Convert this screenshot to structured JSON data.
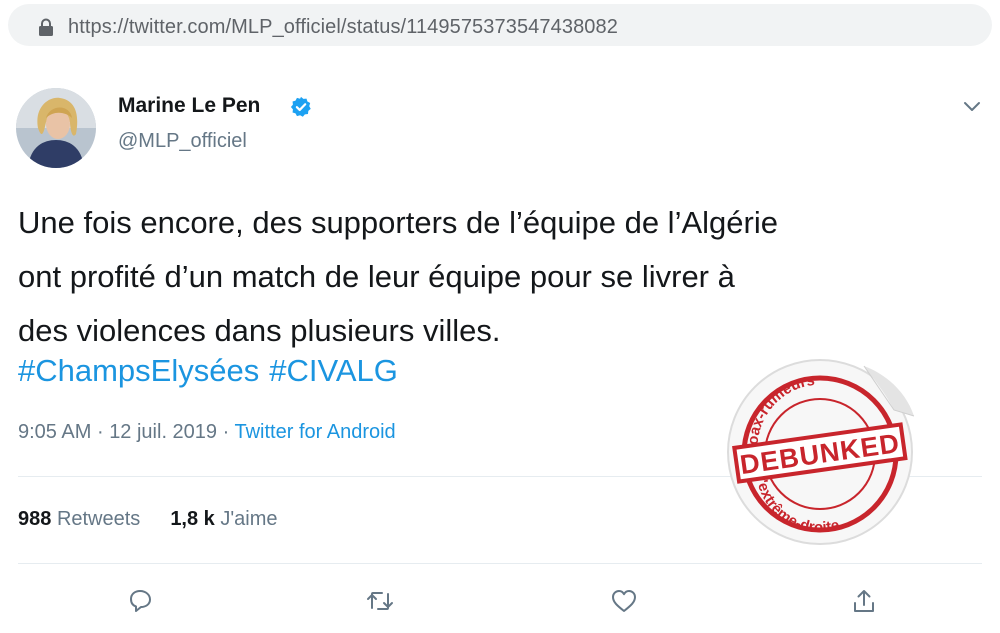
{
  "browser": {
    "url": "https://twitter.com/MLP_officiel/status/1149575373547438082"
  },
  "tweet": {
    "author_name": "Marine Le Pen",
    "author_handle": "@MLP_officiel",
    "text_lines": [
      "Une fois encore, des supporters de l’équipe de l’Algérie",
      "ont profité d’un match de leur équipe pour se livrer à",
      "des violences dans plusieurs villes."
    ],
    "hashtags": [
      "#ChampsElysées",
      "#CIVALG"
    ],
    "time": "9:05 AM",
    "separator": "·",
    "date": "12 juil. 2019",
    "source": "Twitter for Android",
    "retweets_count": "988",
    "retweets_label": "Retweets",
    "likes_count": "1,8 k",
    "likes_label": "J'aime"
  },
  "stamp": {
    "top_text": "Hoax-rumeurs",
    "center_text": "DEBUNKED",
    "bottom_text": "d'extrême-droite"
  },
  "colors": {
    "link": "#1b95e0",
    "secondary_text": "#657786",
    "stamp_red": "#c8252c"
  },
  "icons": [
    "lock-icon",
    "verified-badge-icon",
    "chevron-down-icon",
    "reply-icon",
    "retweet-icon",
    "like-icon",
    "share-icon"
  ]
}
